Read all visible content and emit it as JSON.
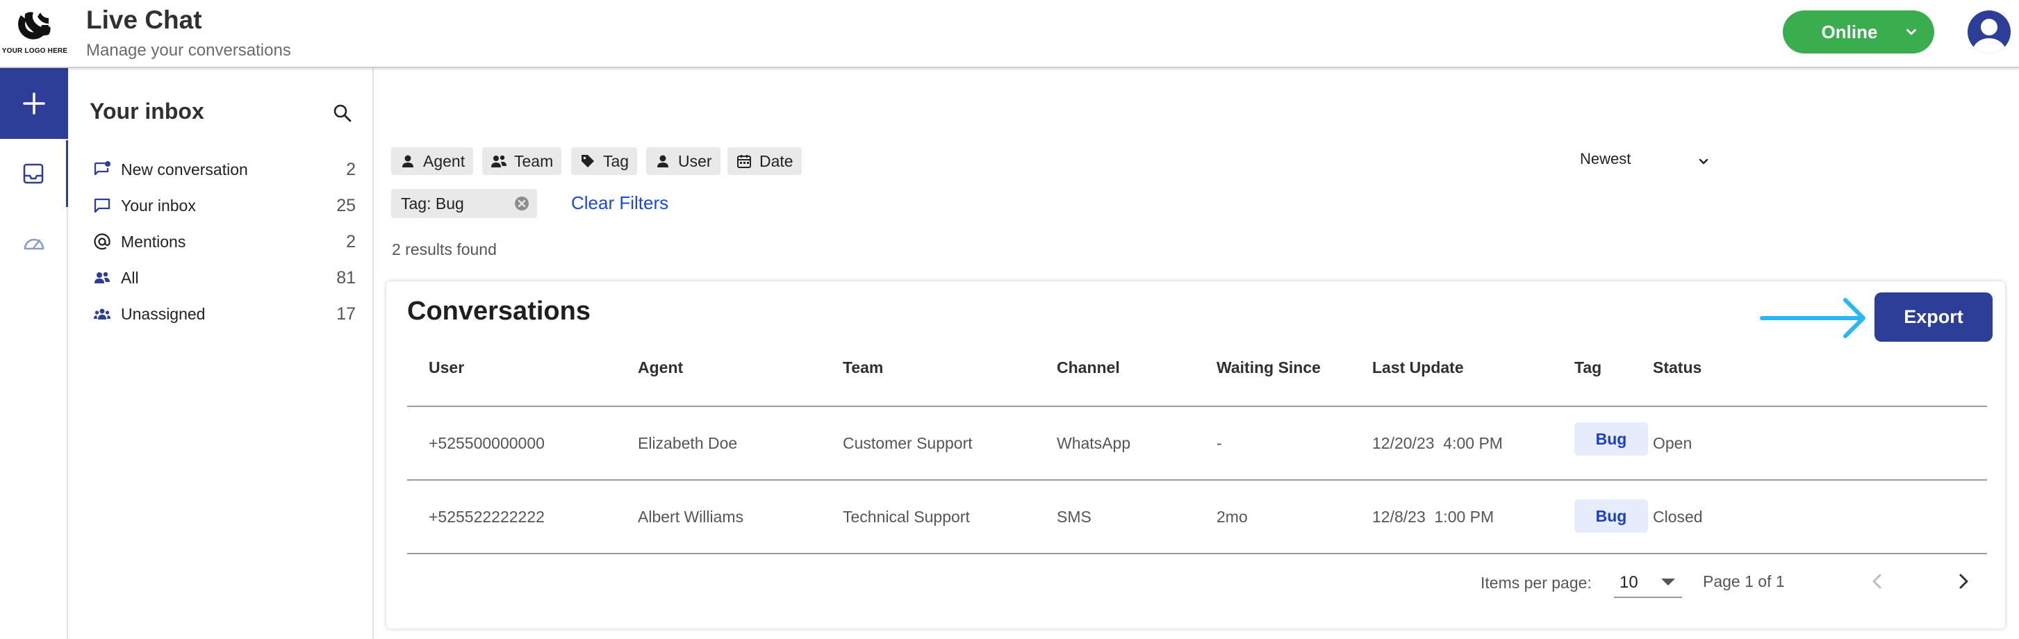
{
  "header": {
    "logo_caption": "YOUR LOGO HERE",
    "title": "Live Chat",
    "subtitle": "Manage your conversations",
    "status_label": "Online",
    "status_color": "#3aae4f"
  },
  "rail": {
    "items": [
      {
        "name": "new",
        "icon": "plus-icon"
      },
      {
        "name": "inbox",
        "icon": "inbox-tray-icon",
        "active": true
      },
      {
        "name": "dashboard",
        "icon": "gauge-icon"
      }
    ]
  },
  "inbox": {
    "title": "Your inbox",
    "items": [
      {
        "label": "New conversation",
        "count": "2",
        "icon": "new-chat-icon"
      },
      {
        "label": "Your inbox",
        "count": "25",
        "icon": "chat-bubble-icon"
      },
      {
        "label": "Mentions",
        "count": "2",
        "icon": "at-icon"
      },
      {
        "label": "All",
        "count": "81",
        "icon": "people-icon"
      },
      {
        "label": "Unassigned",
        "count": "17",
        "icon": "group-icon"
      }
    ]
  },
  "filters": {
    "chips": [
      {
        "label": "Agent",
        "icon": "person-icon"
      },
      {
        "label": "Team",
        "icon": "team-icon"
      },
      {
        "label": "Tag",
        "icon": "tag-icon"
      },
      {
        "label": "User",
        "icon": "person-icon"
      },
      {
        "label": "Date",
        "icon": "calendar-icon"
      }
    ],
    "sort": "Newest",
    "active_filter": "Tag: Bug",
    "clear_label": "Clear Filters",
    "results_text": "2 results found"
  },
  "conversations": {
    "title": "Conversations",
    "export_label": "Export",
    "columns": [
      "User",
      "Agent",
      "Team",
      "Channel",
      "Waiting Since",
      "Last Update",
      "Tag",
      "Status"
    ],
    "rows": [
      {
        "user": "+525500000000",
        "agent": "Elizabeth Doe",
        "team": "Customer Support",
        "channel": "WhatsApp",
        "waiting": "-",
        "last_update": "12/20/23  4:00 PM",
        "tag": "Bug",
        "status": "Open"
      },
      {
        "user": "+525522222222",
        "agent": "Albert Williams",
        "team": "Technical Support",
        "channel": "SMS",
        "waiting": "2mo",
        "last_update": "12/8/23  1:00 PM",
        "tag": "Bug",
        "status": "Closed"
      }
    ],
    "pagination": {
      "items_per_page_label": "Items per page:",
      "items_per_page": "10",
      "range": "Page 1 of 1"
    }
  },
  "colors": {
    "primary": "#2c3e97",
    "online": "#3aae4f",
    "link": "#1a47e5",
    "arrow": "#29b6f6",
    "tag_bg": "#e6ecfb"
  }
}
